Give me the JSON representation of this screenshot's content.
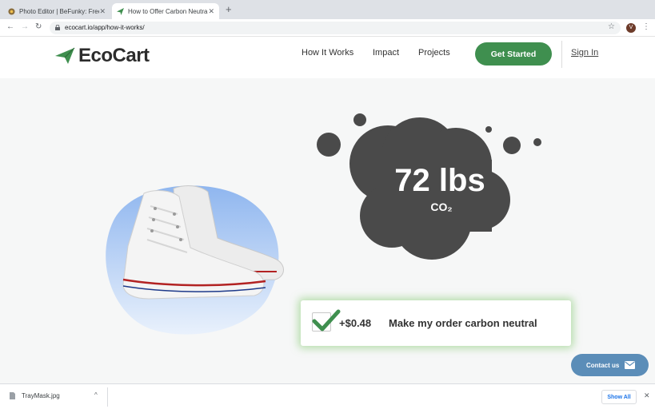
{
  "browser": {
    "tabs": [
      {
        "title": "Photo Editor | BeFunky: Free O",
        "active": false
      },
      {
        "title": "How to Offer Carbon Neutral S",
        "active": true
      }
    ],
    "new_tab": "+",
    "close_glyph": "✕",
    "url": "ecocart.io/app/how-it-works/",
    "profile_initial": "V",
    "nav": {
      "back": "←",
      "forward": "→",
      "reload": "↻"
    },
    "star": "☆",
    "menu": "⋮"
  },
  "site": {
    "brand": "EcoCart",
    "brand_color": "#3f8f4f",
    "nav": {
      "how_it_works": "How It Works",
      "impact": "Impact",
      "projects": "Projects"
    },
    "cta": "Get Started",
    "signin": "Sign In"
  },
  "hero": {
    "co2_value": "72 lbs",
    "co2_unit": "CO₂",
    "offer_price": "+$0.48",
    "offer_label": "Make my order carbon neutral",
    "offer_checked": true,
    "cloud_color": "#4a4a4a",
    "blob_color": "#a9c8f2"
  },
  "contact": {
    "label": "Contact us",
    "icon": "mail-icon"
  },
  "downloads": {
    "file": "TrayMask.jpg",
    "chevron": "^",
    "show_all": "Show All",
    "close": "✕"
  }
}
